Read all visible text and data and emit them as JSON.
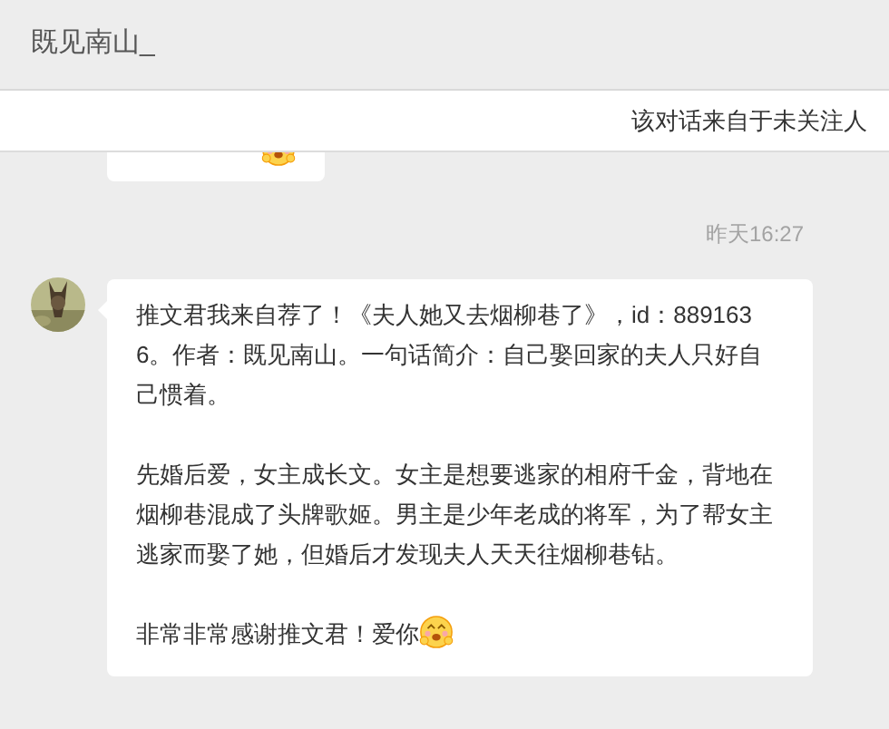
{
  "header": {
    "title": "既见南山_"
  },
  "notice": {
    "text": "该对话来自于未关注人"
  },
  "timestamp": "昨天16:27",
  "message": {
    "paragraphs": [
      "推文君我来自荐了！《夫人她又去烟柳巷了》，id：8891636。作者：既见南山。一句话简介：自己娶回家的夫人只好自己惯着。",
      "先婚后爱，女主成长文。女主是想要逃家的相府千金，背地在烟柳巷混成了头牌歌姬。男主是少年老成的将军，为了帮女主逃家而娶了她，但婚后才发现夫人天天往烟柳巷钻。",
      "非常非常感谢推文君！爱你"
    ]
  }
}
